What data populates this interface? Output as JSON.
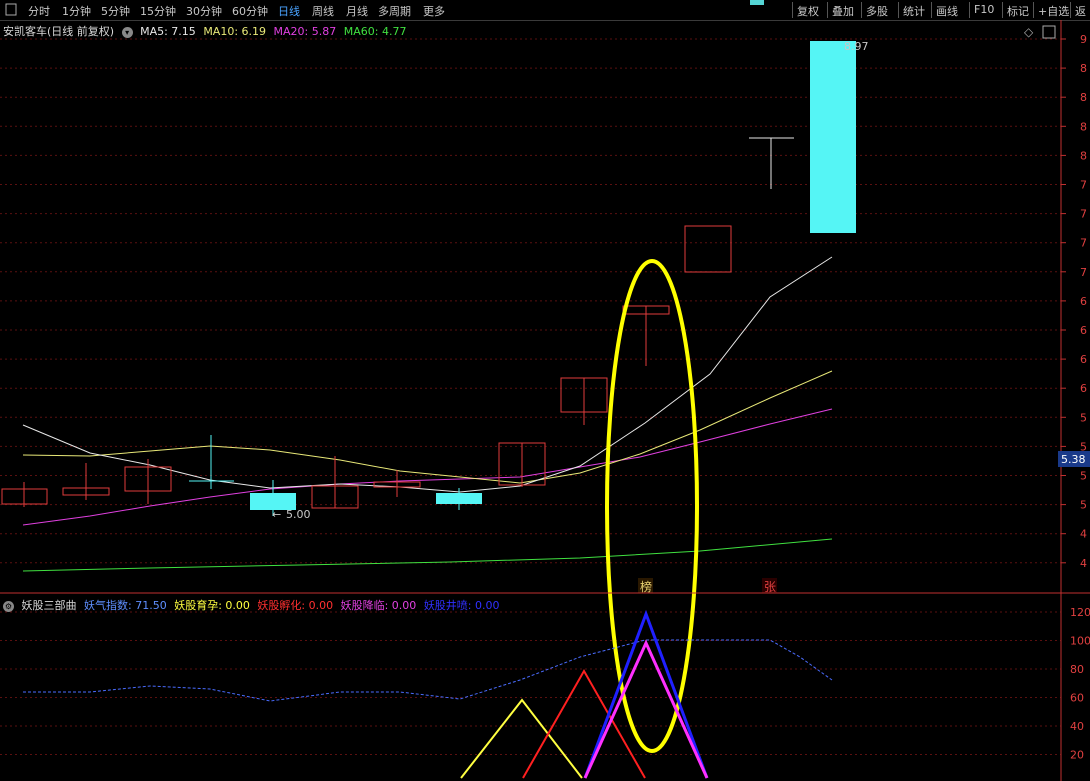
{
  "toolbar": {
    "periods": [
      {
        "label": "分时",
        "active": false
      },
      {
        "label": "1分钟",
        "active": false
      },
      {
        "label": "5分钟",
        "active": false
      },
      {
        "label": "15分钟",
        "active": false
      },
      {
        "label": "30分钟",
        "active": false
      },
      {
        "label": "60分钟",
        "active": false
      },
      {
        "label": "日线",
        "active": true
      },
      {
        "label": "周线",
        "active": false
      },
      {
        "label": "月线",
        "active": false
      },
      {
        "label": "多周期",
        "active": false
      },
      {
        "label": "更多",
        "active": false
      }
    ],
    "tools": [
      "复权",
      "叠加",
      "多股",
      "统计",
      "画线",
      "F10",
      "标记",
      "+自选",
      "返"
    ]
  },
  "main": {
    "stock_name": "安凯客车(日线 前复权)",
    "ma5": "MA5: 7.15",
    "ma10": "MA10: 6.19",
    "ma20": "MA20: 5.87",
    "ma60": "MA60: 4.77",
    "high_label": "8.97",
    "low_label": "5.00",
    "current_price": "5.38",
    "mark_bang": "榜",
    "mark_zhang": "张",
    "price_axis": [
      "9",
      "8",
      "8",
      "8",
      "8",
      "7",
      "7",
      "7",
      "7",
      "6",
      "6",
      "6",
      "6",
      "5",
      "5",
      "5",
      "5",
      "4",
      "4"
    ]
  },
  "sub": {
    "title": "妖股三部曲",
    "yaoqi": "妖气指数: 71.50",
    "yunyu": "妖股育孕: 0.00",
    "fuhua": "妖股孵化: 0.00",
    "jianglin": "妖股降临: 0.00",
    "jingpen": "妖股井喷: 0.00",
    "axis": [
      "120",
      "100",
      "80",
      "60",
      "40",
      "20"
    ]
  },
  "colors": {
    "up": "#e03c3c",
    "down": "#55f5f5",
    "ma5": "#e8e8e8",
    "ma10": "#e8e878",
    "ma20": "#e040e0",
    "ma60": "#40e040",
    "highlight": "#ffff00"
  },
  "icons": [
    "menu-icon",
    "dropdown-icon",
    "diamond-icon",
    "scroll-box-icon"
  ]
}
